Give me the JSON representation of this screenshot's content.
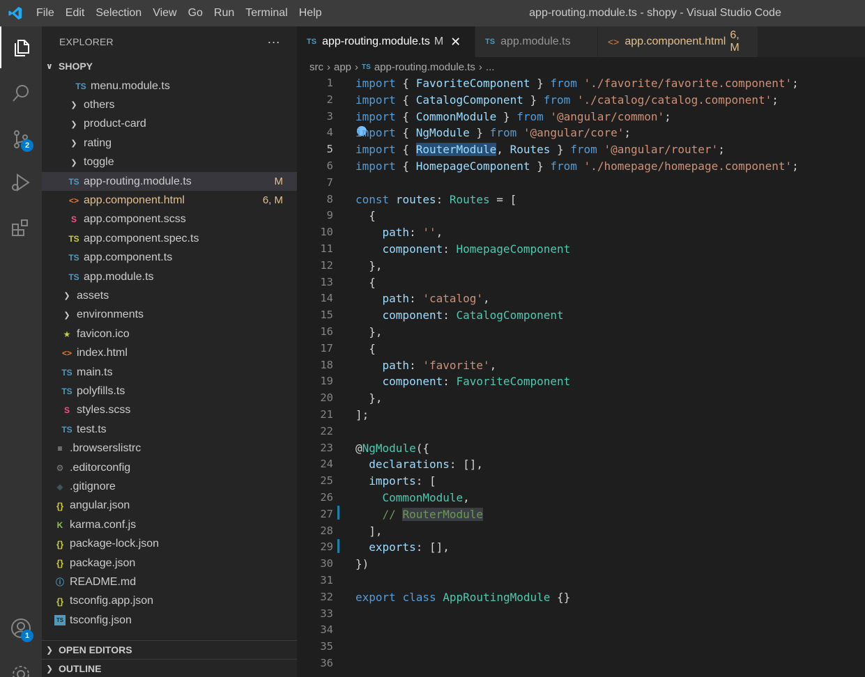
{
  "titlebar": {
    "menu": [
      "File",
      "Edit",
      "Selection",
      "View",
      "Go",
      "Run",
      "Terminal",
      "Help"
    ],
    "window_title": "app-routing.module.ts - shopy - Visual Studio Code"
  },
  "activity_bar": {
    "items": [
      {
        "icon": "explorer-icon",
        "active": true
      },
      {
        "icon": "search-icon"
      },
      {
        "icon": "source-control-icon",
        "badge": "2"
      },
      {
        "icon": "run-debug-icon"
      },
      {
        "icon": "extensions-icon"
      }
    ],
    "accounts": {
      "icon": "accounts-icon",
      "badge": "1"
    },
    "settings": {
      "icon": "gear-icon"
    }
  },
  "sidebar": {
    "title": "EXPLORER",
    "more": "···",
    "project": "SHOPY",
    "tree": [
      {
        "indent": 3,
        "icon": "ts",
        "label": "menu.module.ts"
      },
      {
        "indent": 2,
        "icon": "chevron",
        "label": "others"
      },
      {
        "indent": 2,
        "icon": "chevron",
        "label": "product-card"
      },
      {
        "indent": 2,
        "icon": "chevron",
        "label": "rating"
      },
      {
        "indent": 2,
        "icon": "chevron",
        "label": "toggle"
      },
      {
        "indent": 2,
        "icon": "ts",
        "label": "app-routing.module.ts",
        "status": "M",
        "selected": true
      },
      {
        "indent": 2,
        "icon": "html",
        "label": "app.component.html",
        "status": "6, M",
        "modified": true
      },
      {
        "indent": 2,
        "icon": "scss",
        "label": "app.component.scss"
      },
      {
        "indent": 2,
        "icon": "ts-spec",
        "label": "app.component.spec.ts"
      },
      {
        "indent": 2,
        "icon": "ts",
        "label": "app.component.ts"
      },
      {
        "indent": 2,
        "icon": "ts",
        "label": "app.module.ts"
      },
      {
        "indent": 1,
        "icon": "chevron",
        "label": "assets"
      },
      {
        "indent": 1,
        "icon": "chevron",
        "label": "environments"
      },
      {
        "indent": 1,
        "icon": "star",
        "label": "favicon.ico"
      },
      {
        "indent": 1,
        "icon": "html",
        "label": "index.html"
      },
      {
        "indent": 1,
        "icon": "ts",
        "label": "main.ts"
      },
      {
        "indent": 1,
        "icon": "ts",
        "label": "polyfills.ts"
      },
      {
        "indent": 1,
        "icon": "scss",
        "label": "styles.scss"
      },
      {
        "indent": 1,
        "icon": "ts",
        "label": "test.ts"
      },
      {
        "indent": 0,
        "icon": "lines",
        "label": ".browserslistrc"
      },
      {
        "indent": 0,
        "icon": "gear",
        "label": ".editorconfig"
      },
      {
        "indent": 0,
        "icon": "diamond",
        "label": ".gitignore"
      },
      {
        "indent": 0,
        "icon": "json",
        "label": "angular.json"
      },
      {
        "indent": 0,
        "icon": "karma",
        "label": "karma.conf.js"
      },
      {
        "indent": 0,
        "icon": "json",
        "label": "package-lock.json"
      },
      {
        "indent": 0,
        "icon": "json",
        "label": "package.json"
      },
      {
        "indent": 0,
        "icon": "info",
        "label": "README.md"
      },
      {
        "indent": 0,
        "icon": "json",
        "label": "tsconfig.app.json"
      },
      {
        "indent": 0,
        "icon": "tsconfig",
        "label": "tsconfig.json"
      }
    ],
    "sections": [
      "OPEN EDITORS",
      "OUTLINE"
    ]
  },
  "tabs": [
    {
      "label": "app-routing.module.ts",
      "status": "M",
      "type": "ts",
      "active": true,
      "close": "✕"
    },
    {
      "label": "app.module.ts",
      "type": "ts"
    },
    {
      "label": "app.component.html",
      "status": "6, M",
      "type": "html"
    }
  ],
  "breadcrumb": [
    "src",
    "app",
    "app-routing.module.ts",
    "..."
  ],
  "editor": {
    "current_line": 5,
    "lines": [
      [
        [
          "k",
          "import"
        ],
        [
          "p",
          " { "
        ],
        [
          "v",
          "FavoriteComponent"
        ],
        [
          "p",
          " } "
        ],
        [
          "k",
          "from"
        ],
        [
          "p",
          " "
        ],
        [
          "s",
          "'./favorite/favorite.component'"
        ],
        [
          "p",
          ";"
        ]
      ],
      [
        [
          "k",
          "import"
        ],
        [
          "p",
          " { "
        ],
        [
          "v",
          "CatalogComponent"
        ],
        [
          "p",
          " } "
        ],
        [
          "k",
          "from"
        ],
        [
          "p",
          " "
        ],
        [
          "s",
          "'./catalog/catalog.component'"
        ],
        [
          "p",
          ";"
        ]
      ],
      [
        [
          "k",
          "import"
        ],
        [
          "p",
          " { "
        ],
        [
          "v",
          "CommonModule"
        ],
        [
          "p",
          " } "
        ],
        [
          "k",
          "from"
        ],
        [
          "p",
          " "
        ],
        [
          "s",
          "'@angular/common'"
        ],
        [
          "p",
          ";"
        ]
      ],
      [
        [
          "k",
          "import"
        ],
        [
          "p",
          " { "
        ],
        [
          "v",
          "NgModule"
        ],
        [
          "p",
          " } "
        ],
        [
          "k",
          "from"
        ],
        [
          "p",
          " "
        ],
        [
          "s",
          "'@angular/core'"
        ],
        [
          "p",
          ";"
        ]
      ],
      [
        [
          "k",
          "import"
        ],
        [
          "p",
          " { "
        ],
        [
          "vh",
          "RouterModule"
        ],
        [
          "p",
          ", "
        ],
        [
          "v",
          "Routes"
        ],
        [
          "p",
          " } "
        ],
        [
          "k",
          "from"
        ],
        [
          "p",
          " "
        ],
        [
          "s",
          "'@angular/router'"
        ],
        [
          "p",
          ";"
        ]
      ],
      [
        [
          "k",
          "import"
        ],
        [
          "p",
          " { "
        ],
        [
          "v",
          "HomepageComponent"
        ],
        [
          "p",
          " } "
        ],
        [
          "k",
          "from"
        ],
        [
          "p",
          " "
        ],
        [
          "s",
          "'./homepage/homepage.component'"
        ],
        [
          "p",
          ";"
        ]
      ],
      [],
      [
        [
          "k",
          "const"
        ],
        [
          "p",
          " "
        ],
        [
          "v",
          "routes"
        ],
        [
          "p",
          ": "
        ],
        [
          "t",
          "Routes"
        ],
        [
          "p",
          " = ["
        ]
      ],
      [
        [
          "p",
          "  {"
        ]
      ],
      [
        [
          "p",
          "    "
        ],
        [
          "v",
          "path"
        ],
        [
          "p",
          ": "
        ],
        [
          "s",
          "''"
        ],
        [
          "p",
          ","
        ]
      ],
      [
        [
          "p",
          "    "
        ],
        [
          "v",
          "component"
        ],
        [
          "p",
          ": "
        ],
        [
          "t",
          "HomepageComponent"
        ]
      ],
      [
        [
          "p",
          "  },"
        ]
      ],
      [
        [
          "p",
          "  {"
        ]
      ],
      [
        [
          "p",
          "    "
        ],
        [
          "v",
          "path"
        ],
        [
          "p",
          ": "
        ],
        [
          "s",
          "'catalog'"
        ],
        [
          "p",
          ","
        ]
      ],
      [
        [
          "p",
          "    "
        ],
        [
          "v",
          "component"
        ],
        [
          "p",
          ": "
        ],
        [
          "t",
          "CatalogComponent"
        ]
      ],
      [
        [
          "p",
          "  },"
        ]
      ],
      [
        [
          "p",
          "  {"
        ]
      ],
      [
        [
          "p",
          "    "
        ],
        [
          "v",
          "path"
        ],
        [
          "p",
          ": "
        ],
        [
          "s",
          "'favorite'"
        ],
        [
          "p",
          ","
        ]
      ],
      [
        [
          "p",
          "    "
        ],
        [
          "v",
          "component"
        ],
        [
          "p",
          ": "
        ],
        [
          "t",
          "FavoriteComponent"
        ]
      ],
      [
        [
          "p",
          "  },"
        ]
      ],
      [
        [
          "p",
          "];"
        ]
      ],
      [],
      [
        [
          "p",
          "@"
        ],
        [
          "t",
          "NgModule"
        ],
        [
          "p",
          "({"
        ]
      ],
      [
        [
          "p",
          "  "
        ],
        [
          "v",
          "declarations"
        ],
        [
          "p",
          ": [],"
        ]
      ],
      [
        [
          "p",
          "  "
        ],
        [
          "v",
          "imports"
        ],
        [
          "p",
          ": ["
        ]
      ],
      [
        [
          "p",
          "    "
        ],
        [
          "t",
          "CommonModule"
        ],
        [
          "p",
          ","
        ]
      ],
      [
        [
          "p",
          "    "
        ],
        [
          "c",
          "// "
        ],
        [
          "ch",
          "RouterModule"
        ]
      ],
      [
        [
          "p",
          "  ],"
        ]
      ],
      [
        [
          "p",
          "  "
        ],
        [
          "v",
          "exports"
        ],
        [
          "p",
          ": [],"
        ]
      ],
      [
        [
          "p",
          "})"
        ]
      ],
      [],
      [
        [
          "k",
          "export"
        ],
        [
          "p",
          " "
        ],
        [
          "k",
          "class"
        ],
        [
          "p",
          " "
        ],
        [
          "t",
          "AppRoutingModule"
        ],
        [
          "p",
          " {}"
        ]
      ],
      [],
      [],
      [],
      []
    ]
  }
}
